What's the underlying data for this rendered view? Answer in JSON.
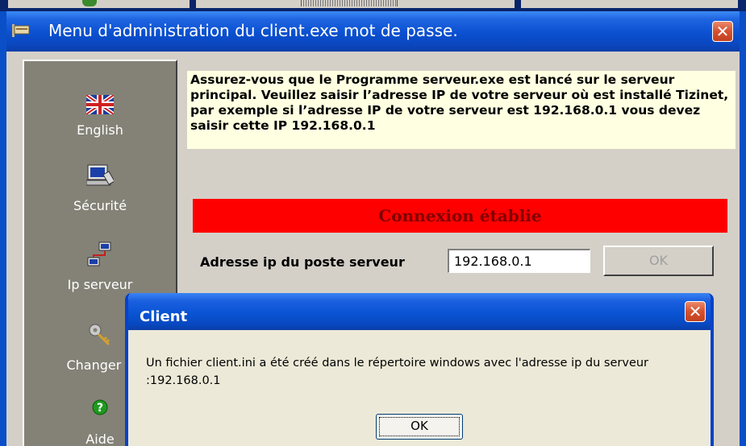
{
  "main_window": {
    "title": "Menu d'administration  du client.exe mot de passe.",
    "close_glyph": "✕"
  },
  "sidebar": {
    "items": [
      {
        "label": "English",
        "icon": "uk-flag-icon"
      },
      {
        "label": "Sécurité",
        "icon": "computer-security-icon"
      },
      {
        "label": "Ip serveur",
        "icon": "network-computers-icon"
      },
      {
        "label": "Changer p",
        "icon": "keys-icon"
      },
      {
        "label": "Aide",
        "icon": "help-icon"
      }
    ]
  },
  "info_text": "Assurez-vous que le Programme serveur.exe est lancé sur le serveur principal. Veuillez saisir l’adresse IP de votre serveur où est installé Tizinet, par exemple si l’adresse IP de votre  serveur est 192.168.0.1 vous devez saisir cette  IP 192.168.0.1",
  "status": {
    "text": "Connexion établie",
    "color": "#ff0000"
  },
  "ip": {
    "label": "Adresse ip du poste serveur",
    "value": "192.168.0.1",
    "ok_label": "OK"
  },
  "dialog": {
    "title": "Client",
    "message": "Un fichier client.ini a été créé dans le répertoire windows avec l'adresse ip du serveur :192.168.0.1",
    "ok_label": "OK",
    "close_glyph": "✕"
  }
}
